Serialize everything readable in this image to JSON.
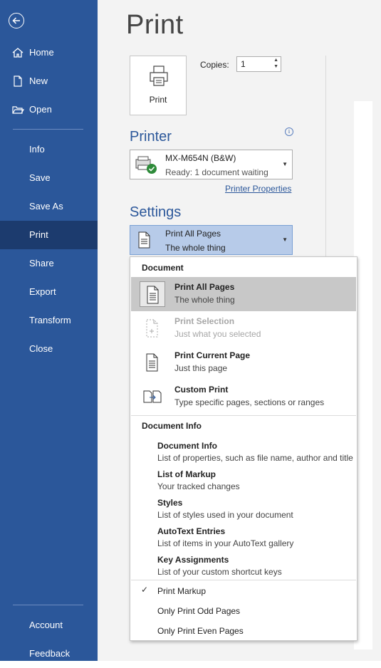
{
  "sidebar": {
    "back_icon": "back-arrow-icon",
    "top_items": [
      {
        "label": "Home",
        "icon": "home-icon"
      },
      {
        "label": "New",
        "icon": "new-document-icon"
      },
      {
        "label": "Open",
        "icon": "folder-open-icon"
      }
    ],
    "items": [
      {
        "label": "Info"
      },
      {
        "label": "Save"
      },
      {
        "label": "Save As"
      },
      {
        "label": "Print"
      },
      {
        "label": "Share"
      },
      {
        "label": "Export"
      },
      {
        "label": "Transform"
      },
      {
        "label": "Close"
      }
    ],
    "bottom_items": [
      {
        "label": "Account"
      },
      {
        "label": "Feedback"
      }
    ],
    "active_item": "Print"
  },
  "main": {
    "title": "Print",
    "print_button_label": "Print",
    "copies_label": "Copies:",
    "copies_value": "1",
    "printer_heading": "Printer",
    "printer": {
      "name": "MX-M654N (B&W)",
      "status": "Ready: 1 document waiting"
    },
    "printer_properties_link": "Printer Properties",
    "settings_heading": "Settings",
    "settings_selected": {
      "title": "Print All Pages",
      "subtitle": "The whole thing"
    }
  },
  "dropdown": {
    "document_heading": "Document",
    "document_items": [
      {
        "title": "Print All Pages",
        "subtitle": "The whole thing",
        "selected": true,
        "enabled": true
      },
      {
        "title": "Print Selection",
        "subtitle": "Just what you selected",
        "selected": false,
        "enabled": false
      },
      {
        "title": "Print Current Page",
        "subtitle": "Just this page",
        "selected": false,
        "enabled": true
      },
      {
        "title": "Custom Print",
        "subtitle": "Type specific pages, sections or ranges",
        "selected": false,
        "enabled": true
      }
    ],
    "info_heading": "Document Info",
    "info_items": [
      {
        "title": "Document Info",
        "subtitle": "List of properties, such as file name, author and title"
      },
      {
        "title": "List of Markup",
        "subtitle": "Your tracked changes"
      },
      {
        "title": "Styles",
        "subtitle": "List of styles used in your document"
      },
      {
        "title": "AutoText Entries",
        "subtitle": "List of items in your AutoText gallery"
      },
      {
        "title": "Key Assignments",
        "subtitle": "List of your custom shortcut keys"
      }
    ],
    "options": [
      {
        "label": "Print Markup",
        "checked": true
      },
      {
        "label": "Only Print Odd Pages",
        "checked": false
      },
      {
        "label": "Only Print Even Pages",
        "checked": false
      }
    ]
  },
  "colors": {
    "sidebar": "#2b579a",
    "sidebar_active": "#1c3b6e",
    "accent": "#2b579a",
    "selection": "#b7cbe9"
  }
}
